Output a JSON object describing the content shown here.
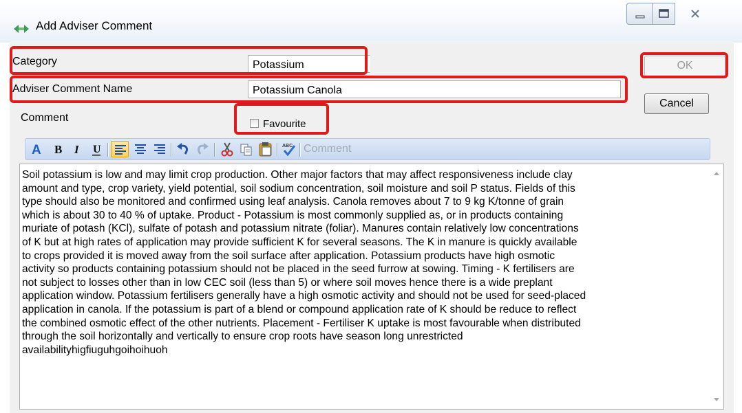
{
  "window": {
    "title": "Add Adviser Comment"
  },
  "form": {
    "category_label": "Category",
    "category_value": "Potassium",
    "name_label": "Adviser Comment Name",
    "name_value": "Potassium Canola",
    "comment_label": "Comment",
    "favourite_label": "Favourite",
    "favourite_checked": false
  },
  "buttons": {
    "ok": "OK",
    "cancel": "Cancel"
  },
  "toolbar": {
    "comment_label": "Comment",
    "spell_label": "ABC"
  },
  "comment_text": "Soil potassium is low and may limit crop production. Other major factors that may affect responsiveness include clay\namount and type, crop variety, yield potential, soil sodium concentration, soil moisture and soil P status. Fields of this\ntype should also be monitored and confirmed using leaf analysis. Canola removes about 7 to 9 kg K/tonne of grain\nwhich is about 30 to 40 % of uptake. Product - Potassium is most commonly supplied as, or in products containing\nmuriate of potash (KCl), sulfate of potash and potassium nitrate (foliar). Manures contain relatively low concentrations\nof K but at high rates of application may provide sufficient K for several seasons. The K in manure is quickly available\nto crops provided it is moved away from the soil surface after application. Potassium products have high osmotic\nactivity so products containing potassium should not be placed in the seed furrow at sowing. Timing - K fertilisers are\nnot subject to losses other than in low CEC soil (less than 5) or where soil moves hence there is a wide preplant\napplication window. Potassium fertilisers generally have a high osmotic activity and should not be used for seed-placed\napplication in canola. If the potassium is part of a blend or compound application rate of K should be reduce to reflect\nthe combined osmotic effect of the other nutrients. Placement - Fertiliser K uptake is most favourable when distributed\nthrough the soil horizontally and vertically to ensure crop roots have season long unrestricted\navailabilityhigfiuguhgoihoihuoh",
  "colors": {
    "highlight": "#e01a1a",
    "toolbar": "#c6d8f0"
  }
}
